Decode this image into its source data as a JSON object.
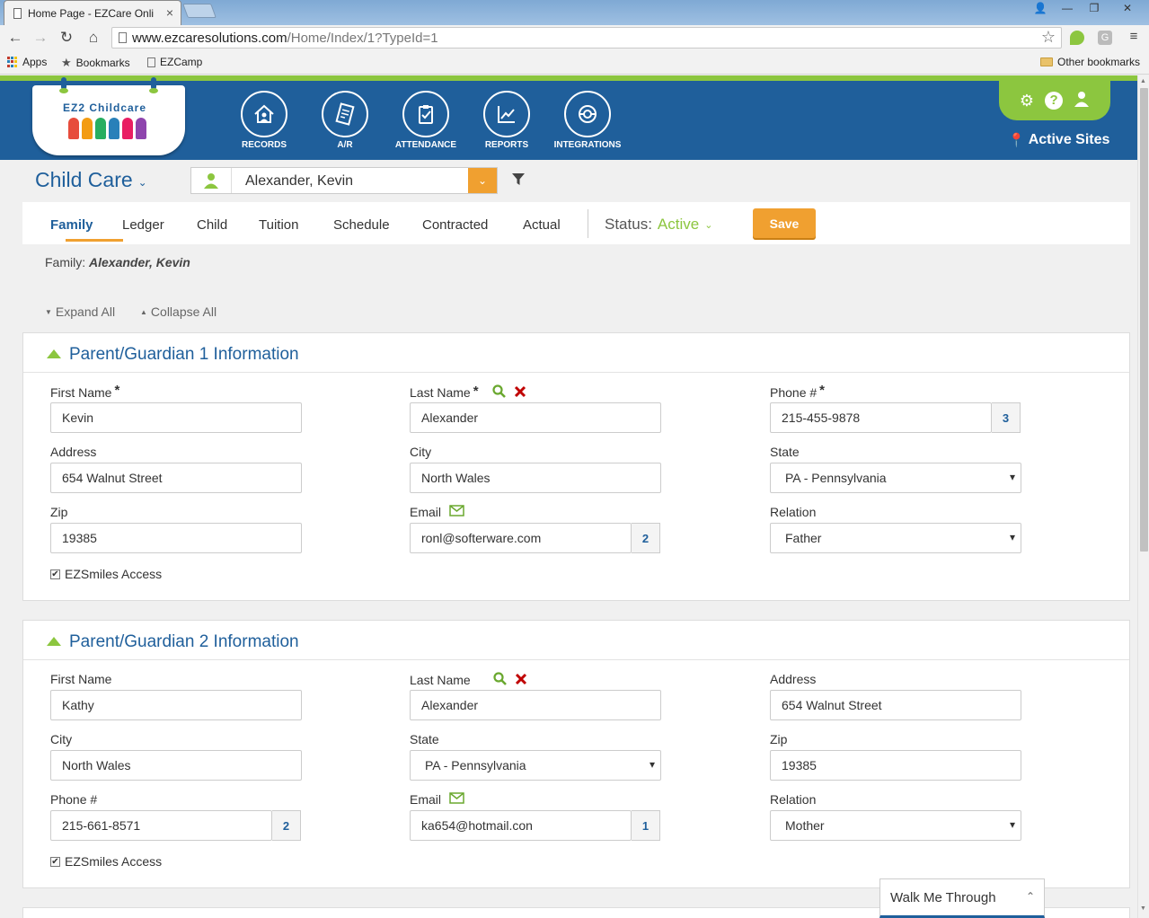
{
  "browser": {
    "tab_title": "Home Page - EZCare Onli",
    "url_host": "www.ezcaresolutions.com",
    "url_path": "/Home/Index/1?TypeId=1",
    "bookmarks": [
      "Apps",
      "Bookmarks",
      "EZCamp"
    ],
    "other_bookmarks": "Other bookmarks"
  },
  "header": {
    "logo_text": "EZ2 Childcare",
    "nav": [
      "RECORDS",
      "A/R",
      "ATTENDANCE",
      "REPORTS",
      "INTEGRATIONS"
    ],
    "active_sites": "Active Sites"
  },
  "toolbar": {
    "module": "Child Care",
    "person": "Alexander, Kevin"
  },
  "tabs": [
    "Family",
    "Ledger",
    "Child",
    "Tuition",
    "Schedule",
    "Contracted",
    "Actual"
  ],
  "status": {
    "label": "Status:",
    "value": "Active"
  },
  "save_label": "Save",
  "family": {
    "label": "Family:",
    "name": "Alexander, Kevin"
  },
  "expand_all": "Expand All",
  "collapse_all": "Collapse All",
  "guardian1": {
    "title": "Parent/Guardian 1 Information",
    "first_name_label": "First Name",
    "first_name": "Kevin",
    "last_name_label": "Last Name",
    "last_name": "Alexander",
    "phone_label": "Phone #",
    "phone": "215-455-9878",
    "phone_count": "3",
    "address_label": "Address",
    "address": "654 Walnut Street",
    "city_label": "City",
    "city": "North Wales",
    "state_label": "State",
    "state": "PA - Pennsylvania",
    "zip_label": "Zip",
    "zip": "19385",
    "email_label": "Email",
    "email": "ronl@softerware.com",
    "email_count": "2",
    "relation_label": "Relation",
    "relation": "Father",
    "ezsmiles": "EZSmiles Access"
  },
  "guardian2": {
    "title": "Parent/Guardian 2 Information",
    "first_name_label": "First Name",
    "first_name": "Kathy",
    "last_name_label": "Last Name",
    "last_name": "Alexander",
    "address_label": "Address",
    "address": "654 Walnut Street",
    "city_label": "City",
    "city": "North Wales",
    "state_label": "State",
    "state": "PA - Pennsylvania",
    "zip_label": "Zip",
    "zip": "19385",
    "phone_label": "Phone #",
    "phone": "215-661-8571",
    "phone_count": "2",
    "email_label": "Email",
    "email": "ka654@hotmail.con",
    "email_count": "1",
    "relation_label": "Relation",
    "relation": "Mother",
    "ezsmiles": "EZSmiles Access"
  },
  "walk_me": "Walk Me Through",
  "colors": {
    "brand_blue": "#1f5f9b",
    "brand_green": "#8cc63f",
    "accent_orange": "#f0a030",
    "delete_red": "#c00000"
  }
}
